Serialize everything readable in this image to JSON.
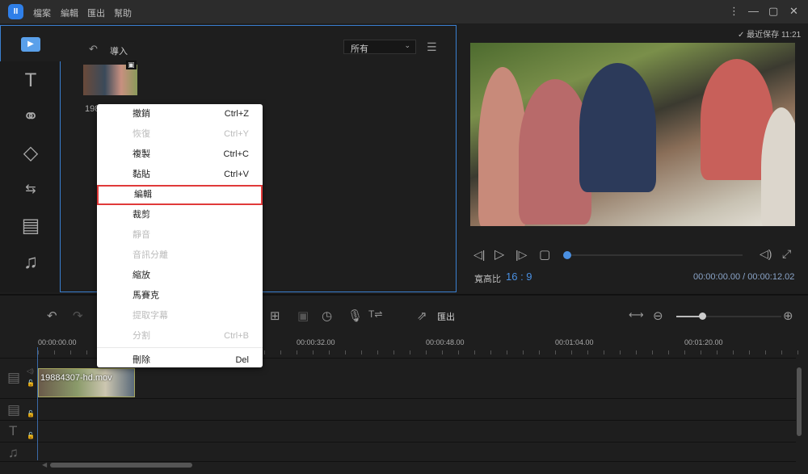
{
  "app": {
    "menus": [
      "檔案",
      "編輯",
      "匯出",
      "幫助"
    ],
    "window_controls": [
      "more-icon",
      "minimize-icon",
      "maximize-icon",
      "close-icon"
    ]
  },
  "media": {
    "import_label": "導入",
    "filter_value": "所有",
    "item_name": "198",
    "sidebar": [
      "media-icon",
      "text-icon",
      "filter-icon",
      "overlay-icon",
      "transition-icon",
      "element-icon",
      "music-icon"
    ]
  },
  "preview": {
    "autosave": "最近保存 11:21",
    "aspect_label": "寬高比",
    "aspect_value": "16 : 9",
    "time": "00:00:00.00 / 00:00:12.02",
    "progress": 0
  },
  "toolbar": {
    "export_label": "匯出",
    "zoom_level": 0.25
  },
  "timeline": {
    "ticks": [
      "00:00:00.00",
      "00:00:32.00",
      "00:00:48.00",
      "00:01:04.00",
      "00:01:20.00"
    ],
    "clip_name": "19884307-hd.mov"
  },
  "context_menu": [
    {
      "label": "撤銷",
      "shortcut": "Ctrl+Z",
      "enabled": true
    },
    {
      "label": "恢復",
      "shortcut": "Ctrl+Y",
      "enabled": false
    },
    {
      "label": "複製",
      "shortcut": "Ctrl+C",
      "enabled": true
    },
    {
      "label": "黏貼",
      "shortcut": "Ctrl+V",
      "enabled": true
    },
    {
      "label": "編輯",
      "shortcut": "",
      "enabled": true,
      "highlighted": true
    },
    {
      "label": "裁剪",
      "shortcut": "",
      "enabled": true
    },
    {
      "label": "靜音",
      "shortcut": "",
      "enabled": false
    },
    {
      "label": "音訊分離",
      "shortcut": "",
      "enabled": false
    },
    {
      "label": "縮放",
      "shortcut": "",
      "enabled": true
    },
    {
      "label": "馬賽克",
      "shortcut": "",
      "enabled": true
    },
    {
      "label": "提取字幕",
      "shortcut": "",
      "enabled": false
    },
    {
      "label": "分割",
      "shortcut": "Ctrl+B",
      "enabled": false
    },
    {
      "label": "刪除",
      "shortcut": "Del",
      "enabled": true
    }
  ],
  "colors": {
    "accent": "#4a90e2",
    "highlight": "#e03a3a"
  }
}
